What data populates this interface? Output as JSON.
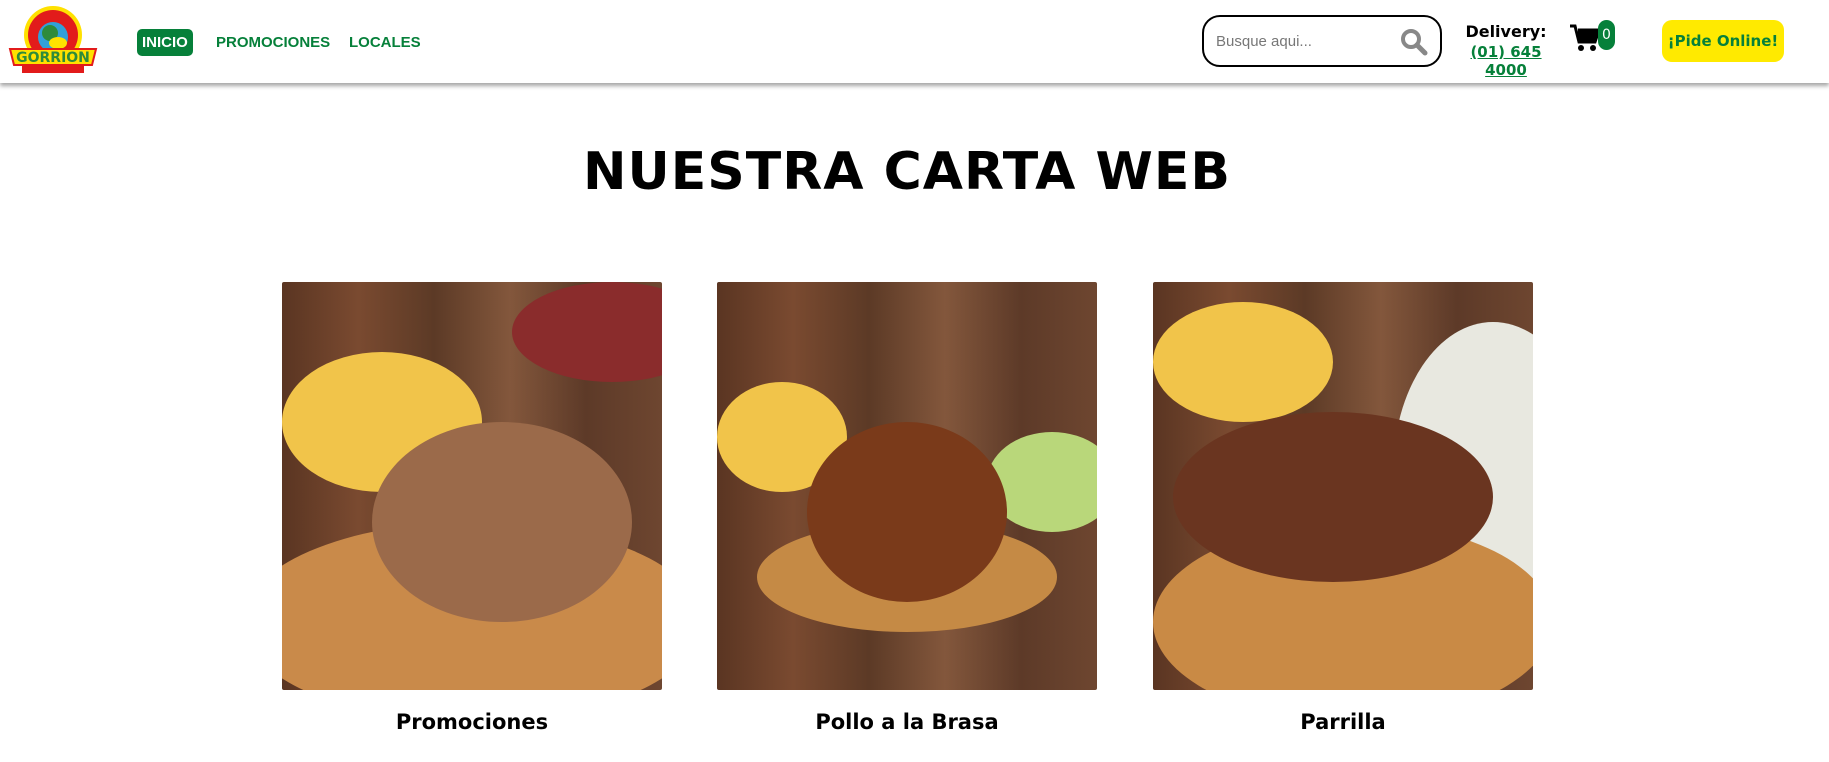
{
  "header": {
    "logo_text": "Restaurant Gorrion - Pollos & Parrillas",
    "nav": [
      {
        "label": "INICIO",
        "active": true
      },
      {
        "label": "PROMOCIONES"
      },
      {
        "label": "LOCALES"
      }
    ],
    "search": {
      "placeholder": "Busque aqui..."
    },
    "delivery": {
      "label": "Delivery:",
      "phone": "(01) 645 4000"
    },
    "cart": {
      "count": "0"
    },
    "cta": "¡Pide Online!"
  },
  "main": {
    "title": "NUESTRA CARTA WEB",
    "cards": [
      {
        "label": "Promociones"
      },
      {
        "label": "Pollo a la Brasa"
      },
      {
        "label": "Parrilla"
      }
    ]
  },
  "colors": {
    "brand_green": "#06803a",
    "cta_yellow": "#ffea00"
  }
}
